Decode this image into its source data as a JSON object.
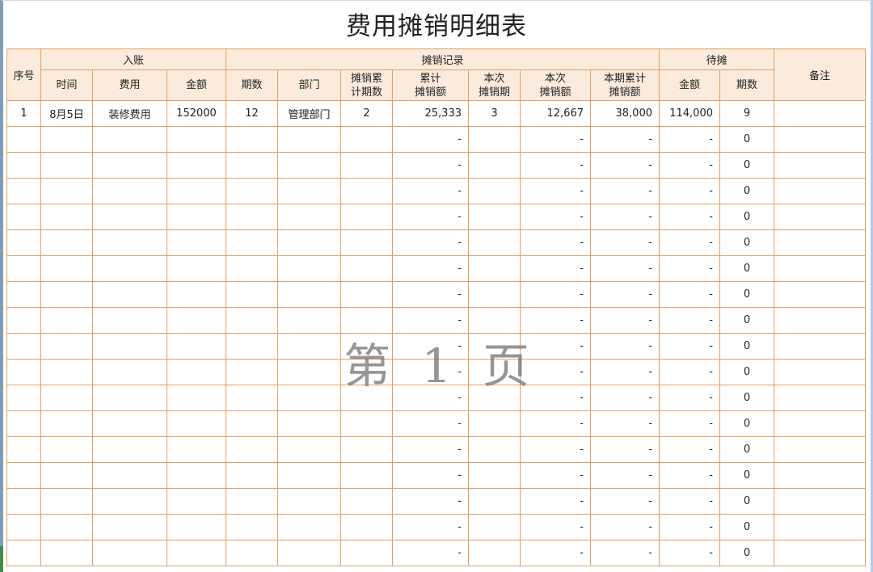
{
  "title": "费用摊销明细表",
  "headers": {
    "seq": "序号",
    "entry_group": "入账",
    "amort_group": "摊销记录",
    "pending_group": "待摊",
    "remark": "备注",
    "time": "时间",
    "expense": "费用",
    "amount": "金额",
    "periods": "期数",
    "dept": "部门",
    "amort_periods_a": "摊销累",
    "amort_periods_b": "计期数",
    "cum_amount_a": "累计",
    "cum_amount_b": "摊销额",
    "this_period_a": "本次",
    "this_period_b": "摊销期",
    "this_amount_a": "本次",
    "this_amount_b": "摊销额",
    "period_cum_a": "本期累计",
    "period_cum_b": "摊销额",
    "pending_amount": "金额",
    "pending_periods": "期数"
  },
  "rows": [
    {
      "seq": "1",
      "time": "8月5日",
      "expense": "装修费用",
      "amount": "152000",
      "periods": "12",
      "dept": "管理部门",
      "amort_periods": "2",
      "cum_amount": "25,333",
      "this_period": "3",
      "this_amount": "12,667",
      "period_cum": "38,000",
      "pending_amount": "114,000",
      "pending_periods": "9",
      "remark": ""
    },
    {
      "seq": "",
      "time": "",
      "expense": "",
      "amount": "",
      "periods": "",
      "dept": "",
      "amort_periods": "",
      "cum_amount": "-",
      "this_period": "",
      "this_amount": "-",
      "period_cum": "-",
      "pending_amount": "-",
      "pending_periods": "0",
      "remark": ""
    },
    {
      "seq": "",
      "time": "",
      "expense": "",
      "amount": "",
      "periods": "",
      "dept": "",
      "amort_periods": "",
      "cum_amount": "-",
      "this_period": "",
      "this_amount": "-",
      "period_cum": "-",
      "pending_amount": "-",
      "pending_periods": "0",
      "remark": ""
    },
    {
      "seq": "",
      "time": "",
      "expense": "",
      "amount": "",
      "periods": "",
      "dept": "",
      "amort_periods": "",
      "cum_amount": "-",
      "this_period": "",
      "this_amount": "-",
      "period_cum": "-",
      "pending_amount": "-",
      "pending_periods": "0",
      "remark": ""
    },
    {
      "seq": "",
      "time": "",
      "expense": "",
      "amount": "",
      "periods": "",
      "dept": "",
      "amort_periods": "",
      "cum_amount": "-",
      "this_period": "",
      "this_amount": "-",
      "period_cum": "-",
      "pending_amount": "-",
      "pending_periods": "0",
      "remark": ""
    },
    {
      "seq": "",
      "time": "",
      "expense": "",
      "amount": "",
      "periods": "",
      "dept": "",
      "amort_periods": "",
      "cum_amount": "-",
      "this_period": "",
      "this_amount": "-",
      "period_cum": "-",
      "pending_amount": "-",
      "pending_periods": "0",
      "remark": ""
    },
    {
      "seq": "",
      "time": "",
      "expense": "",
      "amount": "",
      "periods": "",
      "dept": "",
      "amort_periods": "",
      "cum_amount": "-",
      "this_period": "",
      "this_amount": "-",
      "period_cum": "-",
      "pending_amount": "-",
      "pending_periods": "0",
      "remark": ""
    },
    {
      "seq": "",
      "time": "",
      "expense": "",
      "amount": "",
      "periods": "",
      "dept": "",
      "amort_periods": "",
      "cum_amount": "-",
      "this_period": "",
      "this_amount": "-",
      "period_cum": "-",
      "pending_amount": "-",
      "pending_periods": "0",
      "remark": ""
    },
    {
      "seq": "",
      "time": "",
      "expense": "",
      "amount": "",
      "periods": "",
      "dept": "",
      "amort_periods": "",
      "cum_amount": "-",
      "this_period": "",
      "this_amount": "-",
      "period_cum": "-",
      "pending_amount": "-",
      "pending_periods": "0",
      "remark": ""
    },
    {
      "seq": "",
      "time": "",
      "expense": "",
      "amount": "",
      "periods": "",
      "dept": "",
      "amort_periods": "",
      "cum_amount": "-",
      "this_period": "",
      "this_amount": "-",
      "period_cum": "-",
      "pending_amount": "-",
      "pending_periods": "0",
      "remark": ""
    },
    {
      "seq": "",
      "time": "",
      "expense": "",
      "amount": "",
      "periods": "",
      "dept": "",
      "amort_periods": "",
      "cum_amount": "-",
      "this_period": "",
      "this_amount": "-",
      "period_cum": "-",
      "pending_amount": "-",
      "pending_periods": "0",
      "remark": ""
    },
    {
      "seq": "",
      "time": "",
      "expense": "",
      "amount": "",
      "periods": "",
      "dept": "",
      "amort_periods": "",
      "cum_amount": "-",
      "this_period": "",
      "this_amount": "-",
      "period_cum": "-",
      "pending_amount": "-",
      "pending_periods": "0",
      "remark": ""
    },
    {
      "seq": "",
      "time": "",
      "expense": "",
      "amount": "",
      "periods": "",
      "dept": "",
      "amort_periods": "",
      "cum_amount": "-",
      "this_period": "",
      "this_amount": "-",
      "period_cum": "-",
      "pending_amount": "-",
      "pending_periods": "0",
      "remark": ""
    },
    {
      "seq": "",
      "time": "",
      "expense": "",
      "amount": "",
      "periods": "",
      "dept": "",
      "amort_periods": "",
      "cum_amount": "-",
      "this_period": "",
      "this_amount": "-",
      "period_cum": "-",
      "pending_amount": "-",
      "pending_periods": "0",
      "remark": ""
    },
    {
      "seq": "",
      "time": "",
      "expense": "",
      "amount": "",
      "periods": "",
      "dept": "",
      "amort_periods": "",
      "cum_amount": "-",
      "this_period": "",
      "this_amount": "-",
      "period_cum": "-",
      "pending_amount": "-",
      "pending_periods": "0",
      "remark": ""
    },
    {
      "seq": "",
      "time": "",
      "expense": "",
      "amount": "",
      "periods": "",
      "dept": "",
      "amort_periods": "",
      "cum_amount": "-",
      "this_period": "",
      "this_amount": "-",
      "period_cum": "-",
      "pending_amount": "-",
      "pending_periods": "0",
      "remark": ""
    },
    {
      "seq": "",
      "time": "",
      "expense": "",
      "amount": "",
      "periods": "",
      "dept": "",
      "amort_periods": "",
      "cum_amount": "-",
      "this_period": "",
      "this_amount": "-",
      "period_cum": "-",
      "pending_amount": "-",
      "pending_periods": "0",
      "remark": ""
    },
    {
      "seq": "",
      "time": "",
      "expense": "",
      "amount": "",
      "periods": "",
      "dept": "",
      "amort_periods": "",
      "cum_amount": "-",
      "this_period": "",
      "this_amount": "-",
      "period_cum": "-",
      "pending_amount": "-",
      "pending_periods": "0",
      "remark": ""
    }
  ],
  "watermark": [
    "第",
    "1",
    "页"
  ],
  "colors": {
    "border": "#e1a066",
    "header_fill": "#fcebdc"
  }
}
